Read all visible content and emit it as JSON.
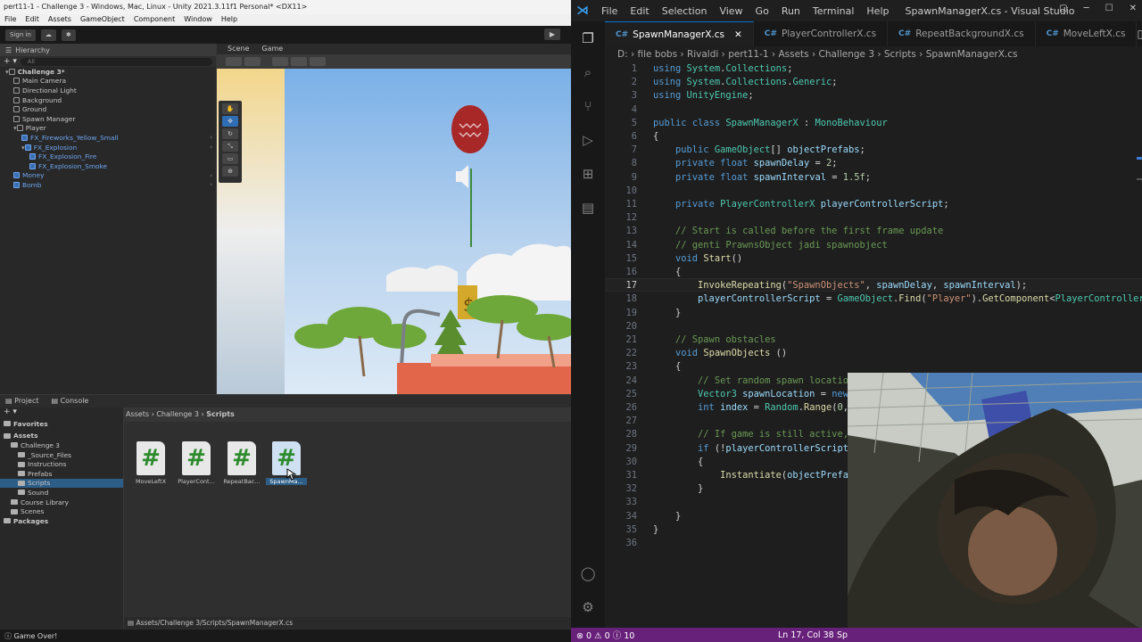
{
  "unity": {
    "window_title": "pert11-1 - Challenge 3 - Windows, Mac, Linux - Unity 2021.3.11f1 Personal* <DX11>",
    "menu": [
      "File",
      "Edit",
      "Assets",
      "GameObject",
      "Component",
      "Window",
      "Help"
    ],
    "toolbar": {
      "sign_in": "Sign in"
    },
    "hierarchy": {
      "tab": "Hierarchy",
      "search_placeholder": "All",
      "items": [
        {
          "label": "Challenge 3*",
          "indent": 0,
          "scene": true
        },
        {
          "label": "Main Camera",
          "indent": 1
        },
        {
          "label": "Directional Light",
          "indent": 1
        },
        {
          "label": "Background",
          "indent": 1
        },
        {
          "label": "Ground",
          "indent": 1
        },
        {
          "label": "Spawn Manager",
          "indent": 1
        },
        {
          "label": "Player",
          "indent": 1
        },
        {
          "label": "FX_Fireworks_Yellow_Small",
          "indent": 2,
          "blue": true
        },
        {
          "label": "FX_Explosion",
          "indent": 2,
          "blue": true
        },
        {
          "label": "FX_Explosion_Fire",
          "indent": 3,
          "blue": true
        },
        {
          "label": "FX_Explosion_Smoke",
          "indent": 3,
          "blue": true
        },
        {
          "label": "Money",
          "indent": 1,
          "blue": true
        },
        {
          "label": "Bomb",
          "indent": 1,
          "blue": true
        }
      ]
    },
    "scene_tabs": [
      "Scene",
      "Game"
    ],
    "project": {
      "tabs": [
        "Project",
        "Console"
      ],
      "tree": [
        {
          "label": "Favorites",
          "indent": 0,
          "bold": true
        },
        {
          "label": "Assets",
          "indent": 0,
          "bold": true
        },
        {
          "label": "Challenge 3",
          "indent": 1
        },
        {
          "label": "_Source_Files",
          "indent": 2
        },
        {
          "label": "Instructions",
          "indent": 2
        },
        {
          "label": "Prefabs",
          "indent": 2
        },
        {
          "label": "Scripts",
          "indent": 2,
          "selected": true
        },
        {
          "label": "Sound",
          "indent": 2
        },
        {
          "label": "Course Library",
          "indent": 1
        },
        {
          "label": "Scenes",
          "indent": 1
        },
        {
          "label": "Packages",
          "indent": 0,
          "bold": true
        }
      ],
      "breadcrumb": [
        "Assets",
        "Challenge 3",
        "Scripts"
      ],
      "assets": [
        "MoveLeftX",
        "PlayerCont...",
        "RepeatBac...",
        "SpawnMa..."
      ],
      "path": "Assets/Challenge 3/Scripts/SpawnManagerX.cs"
    },
    "status": "Game Over!"
  },
  "vscode": {
    "window_title": "SpawnManagerX.cs - Visual Studio",
    "menu": [
      "File",
      "Edit",
      "Selection",
      "View",
      "Go",
      "Run",
      "Terminal",
      "Help"
    ],
    "tabs": [
      {
        "label": "SpawnManagerX.cs",
        "active": true
      },
      {
        "label": "PlayerControllerX.cs",
        "active": false
      },
      {
        "label": "RepeatBackgroundX.cs",
        "active": false
      },
      {
        "label": "MoveLeftX.cs",
        "active": false
      }
    ],
    "breadcrumbs": [
      "D:",
      "file bobs",
      "Rivaldi",
      "pert11-1",
      "Assets",
      "Challenge 3",
      "Scripts",
      "SpawnManagerX.cs"
    ],
    "line_numbers": [
      "1",
      "2",
      "3",
      "4",
      "5",
      "6",
      "7",
      "8",
      "9",
      "10",
      "11",
      "12",
      "13",
      "14",
      "15",
      "16",
      "17",
      "18",
      "19",
      "20",
      "21",
      "22",
      "23",
      "24",
      "25",
      "26",
      "27",
      "28",
      "29",
      "30",
      "31",
      "32",
      "33",
      "34",
      "35",
      "36"
    ],
    "code": [
      "using System.Collections;",
      "using System.Collections.Generic;",
      "using UnityEngine;",
      "",
      "public class SpawnManagerX : MonoBehaviour",
      "{",
      "    public GameObject[] objectPrefabs;",
      "    private float spawnDelay = 2;",
      "    private float spawnInterval = 1.5f;",
      "",
      "    private PlayerControllerX playerControllerScript;",
      "",
      "    // Start is called before the first frame update",
      "    // genti PrawnsObject jadi spawnobject",
      "    void Start()",
      "    {",
      "        InvokeRepeating(\"SpawnObjects\", spawnDelay, spawnInterval);",
      "        playerControllerScript = GameObject.Find(\"Player\").GetComponent<PlayerControllerX",
      "    }",
      "",
      "    // Spawn obstacles",
      "    void SpawnObjects ()",
      "    {",
      "        // Set random spawn location",
      "        Vector3 spawnLocation = new",
      "        int index = Random.Range(0,",
      "",
      "        // If game is still active,",
      "        if (!playerControllerScript",
      "        {",
      "            Instantiate(objectPrefa",
      "        }",
      "",
      "    }",
      "}",
      ""
    ],
    "current_line": 17,
    "status": {
      "errors": "0",
      "warnings": "0",
      "info": "10",
      "position": "Ln 17, Col 38",
      "spaces": "Sp"
    }
  }
}
